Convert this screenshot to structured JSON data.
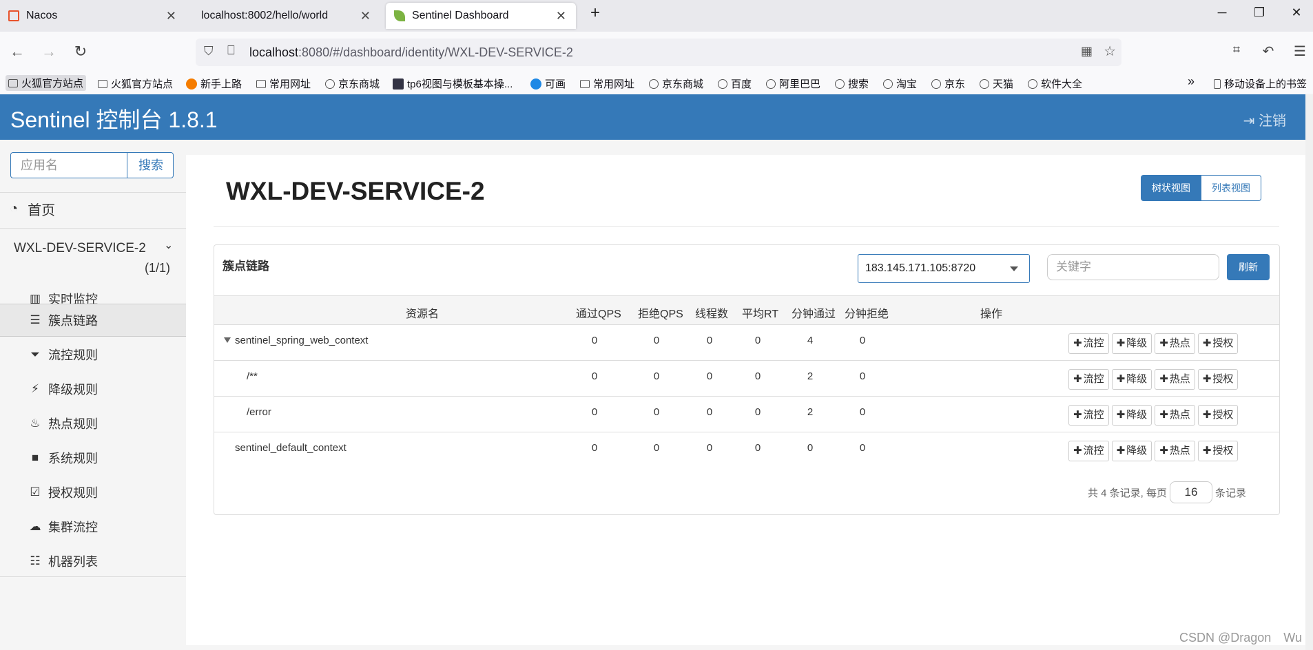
{
  "browser": {
    "tabs": [
      {
        "label": "Nacos"
      },
      {
        "label": "localhost:8002/hello/world"
      },
      {
        "label": "Sentinel Dashboard"
      }
    ],
    "new_tab": "+",
    "url_host": "localhost",
    "url_rest": ":8080/#/dashboard/identity/WXL-DEV-SERVICE-2",
    "bookmarks": [
      "火狐官方站点",
      "火狐官方站点",
      "新手上路",
      "常用网址",
      "京东商城",
      "tp6视图与模板基本操...",
      "可画",
      "常用网址",
      "京东商城",
      "百度",
      "阿里巴巴",
      "搜索",
      "淘宝",
      "京东",
      "天猫",
      "软件大全"
    ],
    "mobile_bookmarks": "移动设备上的书签"
  },
  "header": {
    "title": "Sentinel 控制台 1.8.1",
    "logout": "注销"
  },
  "sidebar": {
    "search_placeholder": "应用名",
    "search_button": "搜索",
    "home": "首页",
    "app_name": "WXL-DEV-SERVICE-2",
    "app_count": "(1/1)",
    "menu": [
      {
        "label": "实时监控",
        "icon": "bar-chart-icon"
      },
      {
        "label": "簇点链路",
        "icon": "list-icon"
      },
      {
        "label": "流控规则",
        "icon": "filter-icon"
      },
      {
        "label": "降级规则",
        "icon": "flash-icon"
      },
      {
        "label": "热点规则",
        "icon": "fire-icon"
      },
      {
        "label": "系统规则",
        "icon": "briefcase-icon"
      },
      {
        "label": "授权规则",
        "icon": "check-icon"
      },
      {
        "label": "集群流控",
        "icon": "cloud-icon"
      },
      {
        "label": "机器列表",
        "icon": "th-list-icon"
      }
    ]
  },
  "main": {
    "title": "WXL-DEV-SERVICE-2",
    "view_tree": "树状视图",
    "view_list": "列表视图",
    "panel_title": "簇点链路",
    "machine": "183.145.171.105:8720",
    "keyword_placeholder": "关键字",
    "refresh": "刷新",
    "columns": [
      "资源名",
      "通过QPS",
      "拒绝QPS",
      "线程数",
      "平均RT",
      "分钟通过",
      "分钟拒绝",
      "操作"
    ],
    "rows": [
      {
        "name": "sentinel_spring_web_context",
        "pass_qps": "0",
        "block_qps": "0",
        "threads": "0",
        "avg_rt": "0",
        "min_pass": "4",
        "min_block": "0"
      },
      {
        "name": "/**",
        "pass_qps": "0",
        "block_qps": "0",
        "threads": "0",
        "avg_rt": "0",
        "min_pass": "2",
        "min_block": "0"
      },
      {
        "name": "/error",
        "pass_qps": "0",
        "block_qps": "0",
        "threads": "0",
        "avg_rt": "0",
        "min_pass": "2",
        "min_block": "0"
      },
      {
        "name": "sentinel_default_context",
        "pass_qps": "0",
        "block_qps": "0",
        "threads": "0",
        "avg_rt": "0",
        "min_pass": "0",
        "min_block": "0"
      }
    ],
    "ops": [
      "流控",
      "降级",
      "热点",
      "授权"
    ],
    "pager_prefix": "共 4 条记录, 每页",
    "page_size": "16",
    "pager_suffix": "条记录"
  },
  "watermark": "CSDN @Dragon　Wu"
}
